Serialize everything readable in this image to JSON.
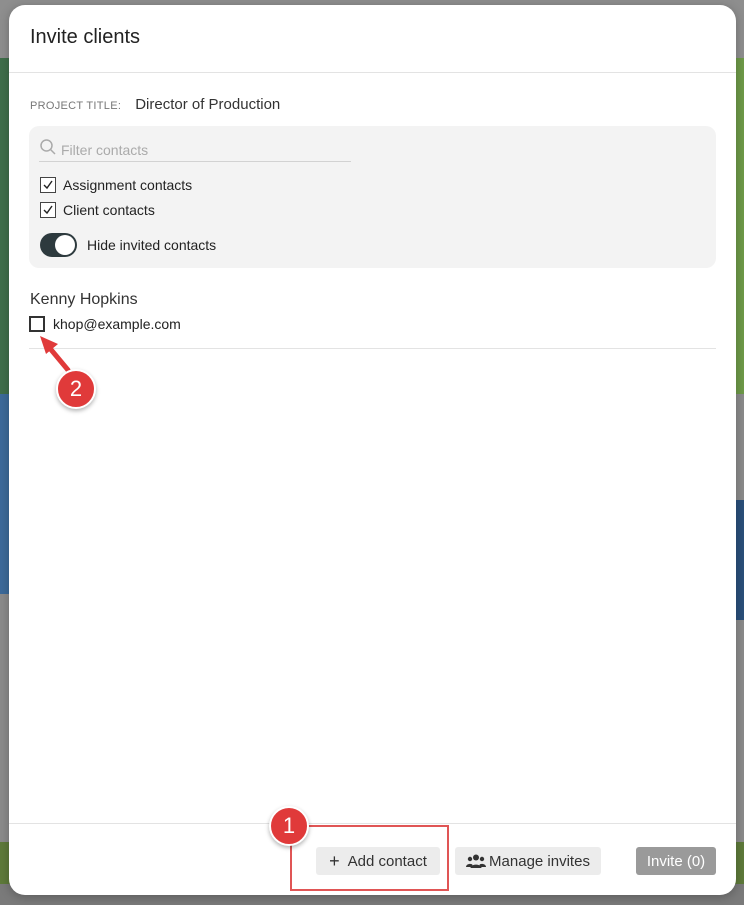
{
  "modal": {
    "title": "Invite clients",
    "project_label": "PROJECT TITLE:",
    "project_value": "Director of Production"
  },
  "filter": {
    "search_placeholder": "Filter contacts",
    "search_icon": "search-icon",
    "options": [
      {
        "label": "Assignment contacts",
        "checked": true
      },
      {
        "label": "Client contacts",
        "checked": true
      }
    ],
    "toggle_label": "Hide invited contacts",
    "toggle_on": true
  },
  "contacts": [
    {
      "name": "Kenny Hopkins",
      "email": "khop@example.com",
      "checked": false
    }
  ],
  "footer": {
    "add_contact_label": "Add contact",
    "manage_invites_label": "Manage invites",
    "invite_label": "Invite (0)"
  },
  "annotations": {
    "badge_1": "1",
    "badge_2": "2",
    "highlight_color": "#e05555",
    "badge_color": "#e03a3a"
  },
  "colors": {
    "toggle_on": "#2d3a3e",
    "invite_button_disabled": "#9a9a9a",
    "panel_background": "#f3f3f3"
  }
}
